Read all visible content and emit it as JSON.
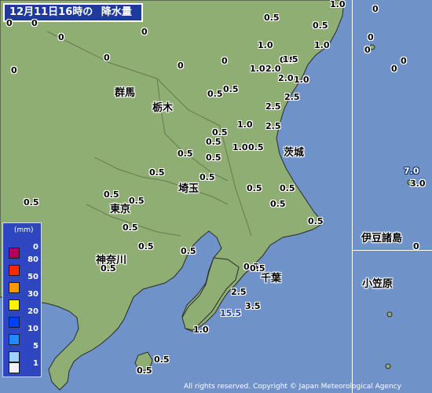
{
  "map": {
    "title_date": "12月11日16時の",
    "title_label": "降水量",
    "copyright": "All rights reserved. Copyright © Japan Meteorological Agency",
    "colors": {
      "sea": "#6f93c9",
      "land": "#8fae73",
      "legend_bg": "#2e46c0"
    }
  },
  "legend": {
    "unit": "(mm)",
    "items": [
      {
        "value": "80",
        "color": "#b4005a"
      },
      {
        "value": "50",
        "color": "#ff2800"
      },
      {
        "value": "30",
        "color": "#ff9900"
      },
      {
        "value": "20",
        "color": "#faf500"
      },
      {
        "value": "10",
        "color": "#0041ff"
      },
      {
        "value": "5",
        "color": "#218cff"
      },
      {
        "value": "1",
        "color": "#a0d2ff"
      },
      {
        "value": "",
        "color": "#f2f2ff"
      }
    ],
    "top_value": "0"
  },
  "places": {
    "gunma": "群馬",
    "tochigi": "栃木",
    "ibaraki": "茨城",
    "saitama": "埼玉",
    "tokyo": "東京",
    "kanagawa": "神奈川",
    "chiba": "千葉",
    "izu": "伊豆諸島",
    "ogasawara": "小笠原"
  },
  "values": {
    "v1": "0",
    "v2": "0",
    "v3": "0.5",
    "v4": "0.5",
    "v5": "0",
    "v6": "0.5",
    "v7": "1.0",
    "v8": "0",
    "v9": "0",
    "v10": "0",
    "v11": "0",
    "v12": "0",
    "v13": "0",
    "v14": "0",
    "v15": "0",
    "v16": "0",
    "v17": "0",
    "v18": "1.0",
    "v19": "1.5",
    "v20": "1.0",
    "v21": "1.0",
    "v22": "2.0",
    "v23": "2.0",
    "v24": "1.0",
    "v25": "0.5",
    "v26": "0.5",
    "v27": "2.5",
    "v28": "2.5",
    "v29": "1.0",
    "v30": "2.5",
    "v31": "1.0",
    "v32": "0.5",
    "v33": "0.5",
    "v34": "0.5",
    "v35": "0.5",
    "v36": "0.5",
    "v37": "0.5",
    "v38": "0.5",
    "v39": "0.5",
    "v40": "0.5",
    "v41": "0.5",
    "v42": "0.5",
    "v43": "0.5",
    "v44": "0.5",
    "v45": "0.5",
    "v46": "0.5",
    "v47": "0.5",
    "v48": "0.5",
    "v49": "0.5",
    "v50": "0.5",
    "v51": "0.5",
    "v52": "2.5",
    "v53": "3.5",
    "v54": "15.5",
    "v55": "1.0",
    "v56": "0.5",
    "v57": "0.5",
    "v58": "7.0",
    "v59": "3.0",
    "v60": "0"
  }
}
